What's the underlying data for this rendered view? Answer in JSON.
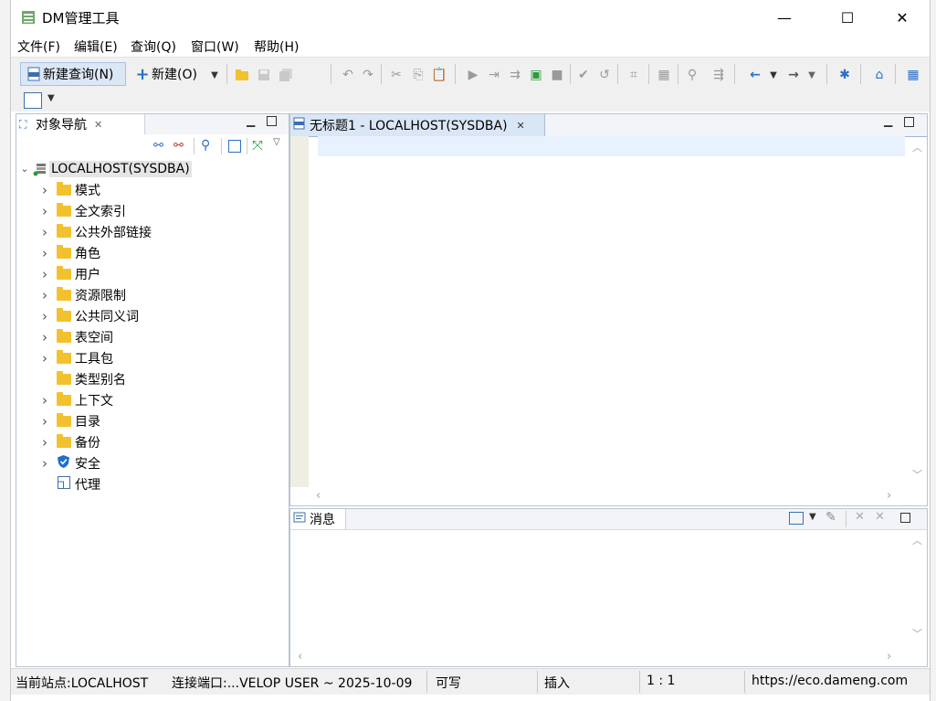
{
  "window": {
    "title": "DM管理工具",
    "minimize": "—",
    "maximize": "☐",
    "close": "✕"
  },
  "menu": [
    "文件(F)",
    "编辑(E)",
    "查询(Q)",
    "窗口(W)",
    "帮助(H)"
  ],
  "toolbar": {
    "new_query_label": "新建查询(N)",
    "new_label": "新建(O)"
  },
  "nav": {
    "tab_label": "对象导航",
    "root": "LOCALHOST(SYSDBA)",
    "items": [
      {
        "label": "模式",
        "icon": "folder",
        "expandable": true
      },
      {
        "label": "全文索引",
        "icon": "folder",
        "expandable": true
      },
      {
        "label": "公共外部链接",
        "icon": "folder",
        "expandable": true
      },
      {
        "label": "角色",
        "icon": "folder",
        "expandable": true
      },
      {
        "label": "用户",
        "icon": "folder",
        "expandable": true
      },
      {
        "label": "资源限制",
        "icon": "folder",
        "expandable": true
      },
      {
        "label": "公共同义词",
        "icon": "folder",
        "expandable": true
      },
      {
        "label": "表空间",
        "icon": "folder",
        "expandable": true
      },
      {
        "label": "工具包",
        "icon": "folder",
        "expandable": true
      },
      {
        "label": "类型别名",
        "icon": "folder",
        "expandable": false
      },
      {
        "label": "上下文",
        "icon": "folder",
        "expandable": true
      },
      {
        "label": "目录",
        "icon": "folder",
        "expandable": true
      },
      {
        "label": "备份",
        "icon": "folder",
        "expandable": true
      },
      {
        "label": "安全",
        "icon": "shield",
        "expandable": true
      },
      {
        "label": "代理",
        "icon": "proxy",
        "expandable": false
      }
    ]
  },
  "editor": {
    "tab_label": "无标题1 - LOCALHOST(SYSDBA)"
  },
  "messages": {
    "tab_label": "消息"
  },
  "status": {
    "site": "当前站点:LOCALHOST",
    "port": "连接端口:...VELOP USER ~ 2025-10-09",
    "mode": "可写",
    "insert": "插入",
    "position": "1 : 1",
    "url": "https://eco.dameng.com"
  },
  "colors": {
    "folder": "#f2c12e",
    "accent_blue": "#2a6fc9",
    "tab_active": "#d9e6f6"
  }
}
